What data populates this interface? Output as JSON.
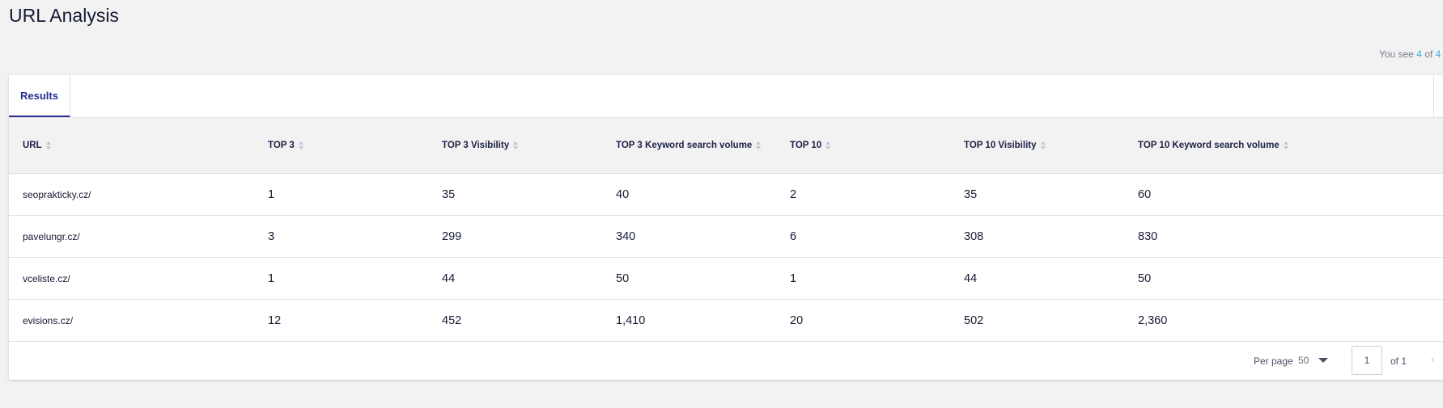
{
  "page": {
    "title": "URL Analysis"
  },
  "counter": {
    "prefix": "You see",
    "shown": "4",
    "of_label": "of",
    "total": "4"
  },
  "tabs": [
    {
      "label": "Results",
      "active": true
    }
  ],
  "table": {
    "columns": [
      "URL",
      "TOP 3",
      "TOP 3 Visibility",
      "TOP 3 Keyword search volume",
      "TOP 10",
      "TOP 10 Visibility",
      "TOP 10 Keyword search volume"
    ],
    "rows": [
      [
        "seoprakticky.cz/",
        "1",
        "35",
        "40",
        "2",
        "35",
        "60"
      ],
      [
        "pavelungr.cz/",
        "3",
        "299",
        "340",
        "6",
        "308",
        "830"
      ],
      [
        "vceliste.cz/",
        "1",
        "44",
        "50",
        "1",
        "44",
        "50"
      ],
      [
        "evisions.cz/",
        "12",
        "452",
        "1,410",
        "20",
        "502",
        "2,360"
      ]
    ]
  },
  "pagination": {
    "per_page_label": "Per page",
    "per_page_value": "50",
    "current_page": "1",
    "of_label": "of 1",
    "prev_icon": "chevron-left-icon"
  },
  "colors": {
    "accent": "#2a2f8f",
    "link": "#2fb0e8",
    "background": "#f2f2f3"
  }
}
